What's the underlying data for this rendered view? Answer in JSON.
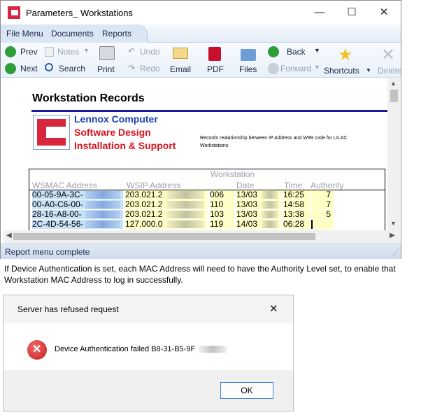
{
  "window": {
    "title": "Parameters_ Workstations",
    "controls": {
      "minimize": "—",
      "maximize": "☐",
      "close": "✕"
    }
  },
  "menu": {
    "items": [
      "File Menu",
      "Documents",
      "Reports"
    ]
  },
  "toolbar": {
    "prev": "Prev",
    "next": "Next",
    "notes": "Notes",
    "search": "Search",
    "print": "Print",
    "undo": "Undo",
    "redo": "Redo",
    "email": "Email",
    "pdf": "PDF",
    "files": "Files",
    "back": "Back",
    "forward": "Forward",
    "shortcuts": "Shortcuts",
    "delete": "Delete"
  },
  "report": {
    "title": "Workstation Records",
    "company_lines": [
      "Lennox Computer",
      "Software Design",
      "Installation & Support"
    ],
    "description": "Records realationship between IP Address and W99 code for LILAC Workstations",
    "headers": {
      "group": "Workstation",
      "mac": "WSMAC Address",
      "ip": "WSIP Address",
      "date": "Date",
      "time": "Time",
      "authority": "Authority"
    },
    "rows": [
      {
        "mac": "00-05-9A-3C-",
        "ip": "203.021.2",
        "code": "006",
        "date": "13/03",
        "time": "16:25",
        "authority": "7"
      },
      {
        "mac": "00-A0-C6-00-",
        "ip": "203.021.2",
        "code": "110",
        "date": "13/03",
        "time": "14:58",
        "authority": "7"
      },
      {
        "mac": "28-16-A8-00-",
        "ip": "203.021.2",
        "code": "103",
        "date": "13/03",
        "time": "13:38",
        "authority": "5"
      },
      {
        "mac": "2C-4D-54-56-",
        "ip": "127.000.0",
        "code": "119",
        "date": "14/03",
        "time": "06:28",
        "authority": ""
      }
    ]
  },
  "status": {
    "text": "Report menu complete"
  },
  "note": "If Device Authentication is set, each MAC  Address will need to have the Authority Level set, to enable that Workstation MAC Address to log in successfully.",
  "dialog": {
    "title": "Server has refused request",
    "close": "✕",
    "message": "Device Authentication failed B8-31-B5-9F",
    "ok": "OK"
  }
}
